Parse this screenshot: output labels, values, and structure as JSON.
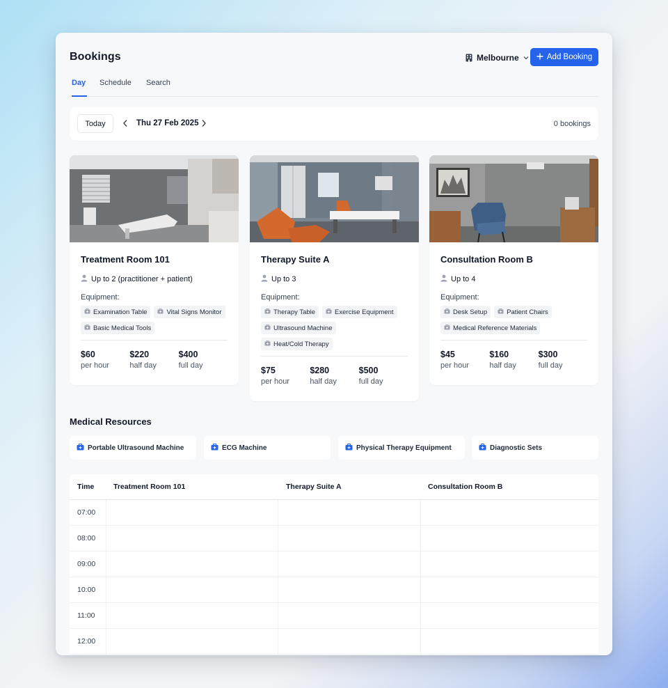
{
  "header": {
    "title": "Bookings",
    "location": "Melbourne",
    "add_label": "Add Booking"
  },
  "tabs": [
    {
      "label": "Day",
      "active": true
    },
    {
      "label": "Schedule",
      "active": false
    },
    {
      "label": "Search",
      "active": false
    }
  ],
  "datebar": {
    "today_label": "Today",
    "date": "Thu 27 Feb 2025",
    "bookings_count": "0 bookings"
  },
  "rooms": [
    {
      "name": "Treatment Room 101",
      "capacity": "Up to 2 (practitioner + patient)",
      "equipment_label": "Equipment:",
      "equipment": [
        "Examination Table",
        "Vital Signs Monitor",
        "Basic Medical Tools"
      ],
      "prices": [
        {
          "amount": "$60",
          "unit": "per hour"
        },
        {
          "amount": "$220",
          "unit": "half day"
        },
        {
          "amount": "$400",
          "unit": "full day"
        }
      ]
    },
    {
      "name": "Therapy Suite A",
      "capacity": "Up to 3",
      "equipment_label": "Equipment:",
      "equipment": [
        "Therapy Table",
        "Exercise Equipment",
        "Ultrasound Machine",
        "Heat/Cold Therapy"
      ],
      "prices": [
        {
          "amount": "$75",
          "unit": "per hour"
        },
        {
          "amount": "$280",
          "unit": "half day"
        },
        {
          "amount": "$500",
          "unit": "full day"
        }
      ]
    },
    {
      "name": "Consultation Room B",
      "capacity": "Up to 4",
      "equipment_label": "Equipment:",
      "equipment": [
        "Desk Setup",
        "Patient Chairs",
        "Medical Reference Materials"
      ],
      "prices": [
        {
          "amount": "$45",
          "unit": "per hour"
        },
        {
          "amount": "$160",
          "unit": "half day"
        },
        {
          "amount": "$300",
          "unit": "full day"
        }
      ]
    }
  ],
  "resources": {
    "title": "Medical Resources",
    "items": [
      "Portable Ultrasound Machine",
      "ECG Machine",
      "Physical Therapy Equipment",
      "Diagnostic Sets"
    ]
  },
  "schedule": {
    "columns": [
      "Time",
      "Treatment Room 101",
      "Therapy Suite A",
      "Consultation Room B"
    ],
    "times": [
      "07:00",
      "08:00",
      "09:00",
      "10:00",
      "11:00",
      "12:00"
    ]
  },
  "colors": {
    "accent": "#2563eb",
    "resource_icon": "#2563eb",
    "chip_bg": "#f3f4f6"
  }
}
